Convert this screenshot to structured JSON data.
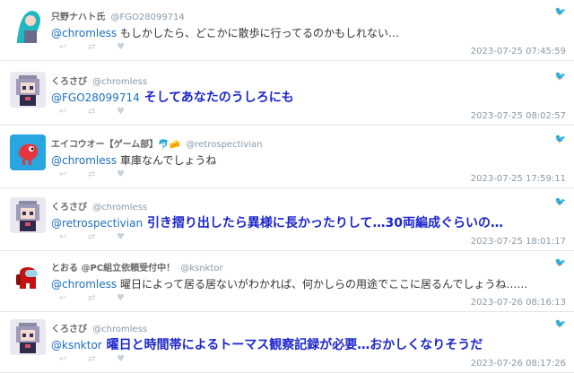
{
  "tweets": [
    {
      "name": "只野ナハト氏",
      "handle": "@FGO28099714",
      "mention": "@chromless",
      "text": "もしかしたら、どこかに散歩に行ってるのかもしれない…",
      "time": "2023-07-25 07:45:59",
      "emphasis": false,
      "avatar": "teal-hair-character"
    },
    {
      "name": "くろさび",
      "handle": "@chromless",
      "mention": "@FGO28099714",
      "text": "そしてあなたのうしろにも",
      "time": "2023-07-25 08:02:57",
      "emphasis": true,
      "avatar": "pixel-girl"
    },
    {
      "name": "エイコウオー【ゲーム部】🐬🧀",
      "handle": "@retrospectivian",
      "mention": "@chromless",
      "text": "車庫なんでしょうね",
      "time": "2023-07-25 17:59:11",
      "emphasis": false,
      "avatar": "red-bird-on-blue"
    },
    {
      "name": "くろさび",
      "handle": "@chromless",
      "mention": "@retrospectivian",
      "text": "引き摺り出したら異様に長かったりして…30両編成ぐらいの…",
      "time": "2023-07-25 18:01:17",
      "emphasis": true,
      "avatar": "pixel-girl"
    },
    {
      "name": "とおる @PC組立依頼受付中！",
      "handle": "@ksnktor",
      "mention": "@chromless",
      "text": "曜日によって居る居ないがわかれば、何かしらの用途でここに居るんでしょうね……",
      "time": "2023-07-26 08:16:13",
      "emphasis": false,
      "avatar": "red-crewmate"
    },
    {
      "name": "くろさび",
      "handle": "@chromless",
      "mention": "@ksnktor",
      "text": "曜日と時間帯によるトーマス観察記録が必要…おかしくなりそうだ",
      "time": "2023-07-26 08:17:26",
      "emphasis": true,
      "avatar": "pixel-girl"
    }
  ],
  "icons": {
    "reply": "reply-icon",
    "retweet": "retweet-icon",
    "like": "heart-icon",
    "source": "twitter-bird-icon"
  },
  "colors": {
    "mention": "#1d6fbf",
    "emphasis": "#1c26cc",
    "meta": "#8899a6"
  }
}
